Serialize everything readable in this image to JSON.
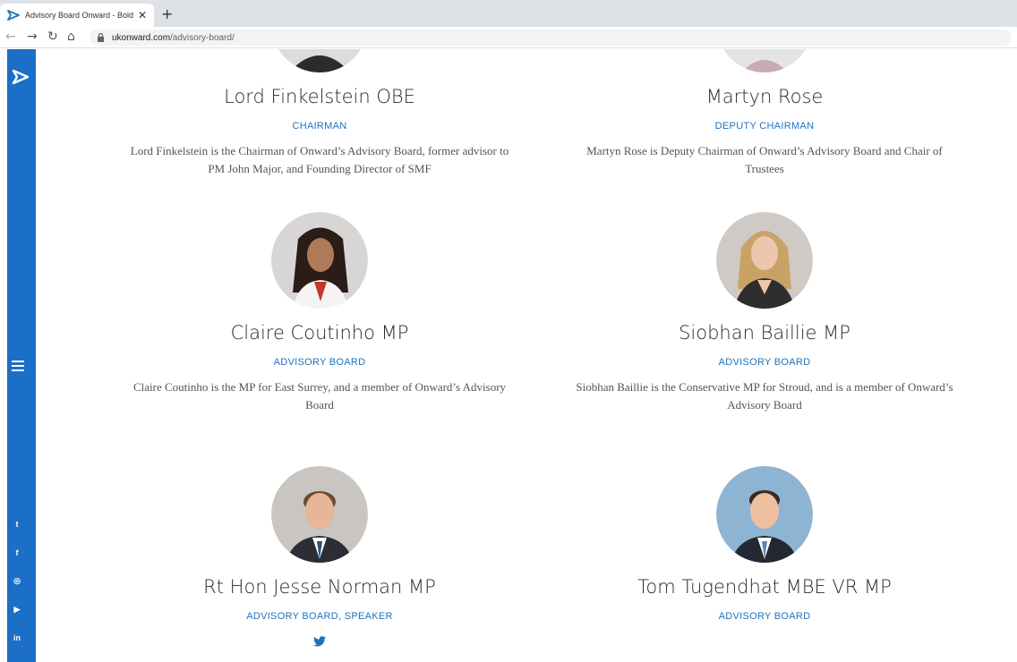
{
  "browser": {
    "tab_title": "Advisory Board Onward - Bold Id",
    "url_domain": "ukonward.com",
    "url_path": "/advisory-board/"
  },
  "sidebar": {
    "social": [
      {
        "name": "twitter",
        "glyph": "t"
      },
      {
        "name": "facebook",
        "glyph": "f"
      },
      {
        "name": "instagram",
        "glyph": "◎"
      },
      {
        "name": "youtube",
        "glyph": "▶"
      },
      {
        "name": "linkedin",
        "glyph": "in"
      }
    ]
  },
  "members": [
    {
      "name": "Lord Finkelstein OBE",
      "role": "CHAIRMAN",
      "bio": "Lord Finkelstein is the Chairman of Onward’s Advisory Board, former advisor to PM John Major, and Founding Director of SMF"
    },
    {
      "name": "Martyn Rose",
      "role": "DEPUTY CHAIRMAN",
      "bio": "Martyn Rose is Deputy Chairman of Onward’s Advisory Board and Chair of Trustees"
    },
    {
      "name": "Claire Coutinho MP",
      "role": "ADVISORY BOARD",
      "bio": "Claire Coutinho is the MP for East Surrey, and a member of Onward’s Advisory Board"
    },
    {
      "name": "Siobhan Baillie MP",
      "role": "ADVISORY BOARD",
      "bio": "Siobhan Baillie is the Conservative MP for Stroud, and is a member of Onward’s Advisory Board"
    },
    {
      "name": "Rt Hon Jesse Norman MP",
      "role": "ADVISORY BOARD, SPEAKER",
      "bio": ""
    },
    {
      "name": "Tom Tugendhat MBE VR MP",
      "role": "ADVISORY BOARD",
      "bio": ""
    }
  ],
  "colors": {
    "sidebar": "#1b6fc7",
    "accent": "#1e73be"
  }
}
